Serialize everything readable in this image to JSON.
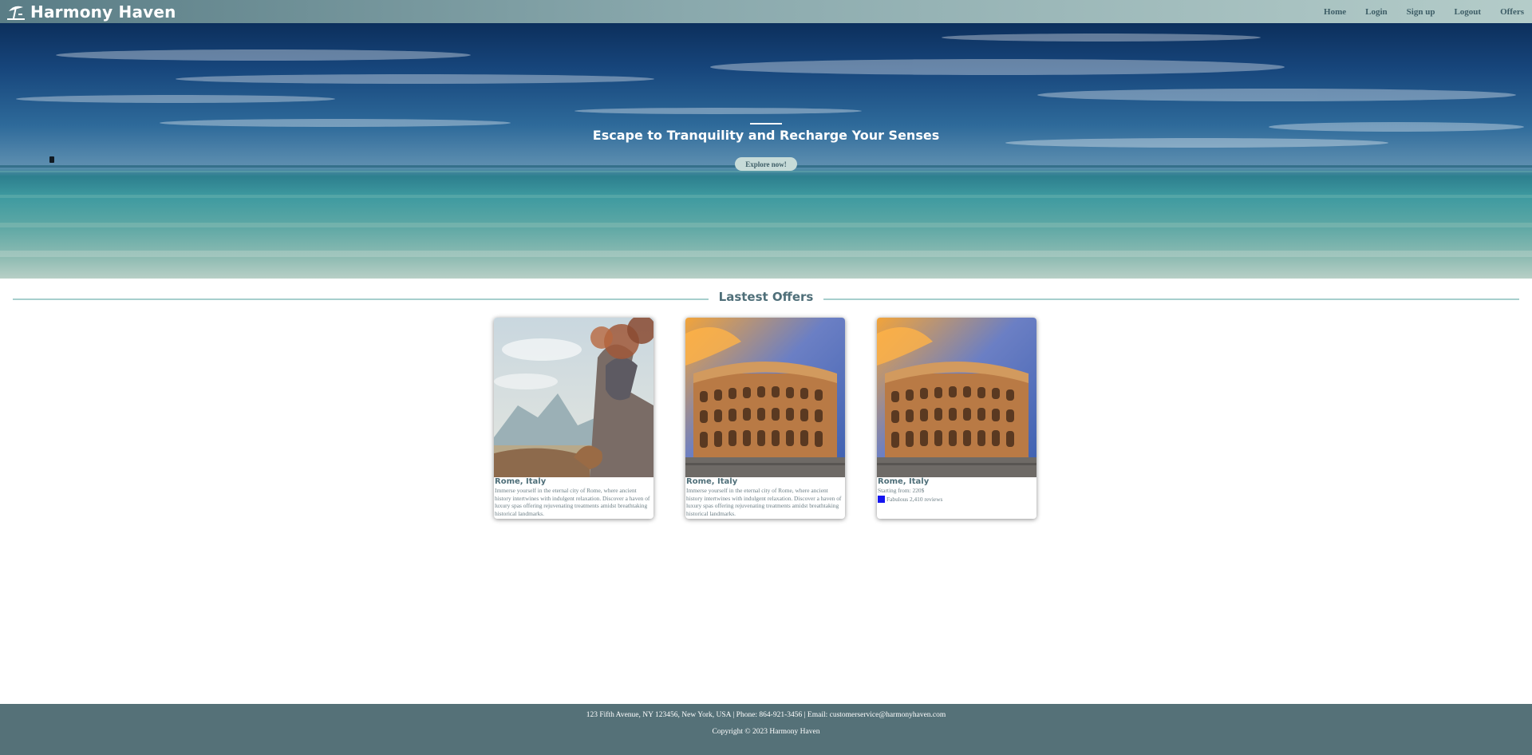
{
  "navbar": {
    "brand": "Harmony Haven",
    "brand_icon": "beach-umbrella-icon",
    "links": [
      "Home",
      "Login",
      "Sign up",
      "Logout",
      "Offers"
    ]
  },
  "hero": {
    "title": "Escape to Tranquility and Recharge Your Senses",
    "button_label": "Explore now!"
  },
  "offers": {
    "heading": "Lastest Offers",
    "cards": [
      {
        "title": "Rome, Italy",
        "description": "Immerse yourself in the eternal city of Rome, where ancient history intertwines with indulgent relaxation. Discover a haven of luxury spas offering rejuvenating treatments amidst breathtaking historical landmarks.",
        "image": "landscape-painting"
      },
      {
        "title": "Rome, Italy",
        "description": "Immerse yourself in the eternal city of Rome, where ancient history intertwines with indulgent relaxation. Discover a haven of luxury spas offering rejuvenating treatments amidst breathtaking historical landmarks.",
        "image": "colosseum-photo"
      },
      {
        "title": "Rome, Italy",
        "price_text": "Starting from: 220$",
        "rating_text": "Fabulous 2,410 reviews",
        "image": "colosseum-photo"
      }
    ]
  },
  "footer": {
    "contact": "123 Fifth Avenue, NY 123456, New York, USA | Phone: 864-921-3456 | Email: customerservice@harmonyhaven.com",
    "copyright": "Copyright © 2023 Harmony Haven"
  },
  "colors": {
    "accent": "#557178",
    "nav_link": "#3d5d66",
    "button_bg": "#c7dbd8",
    "section_line": "#a7cfcd",
    "rating_badge": "#1515f0"
  }
}
